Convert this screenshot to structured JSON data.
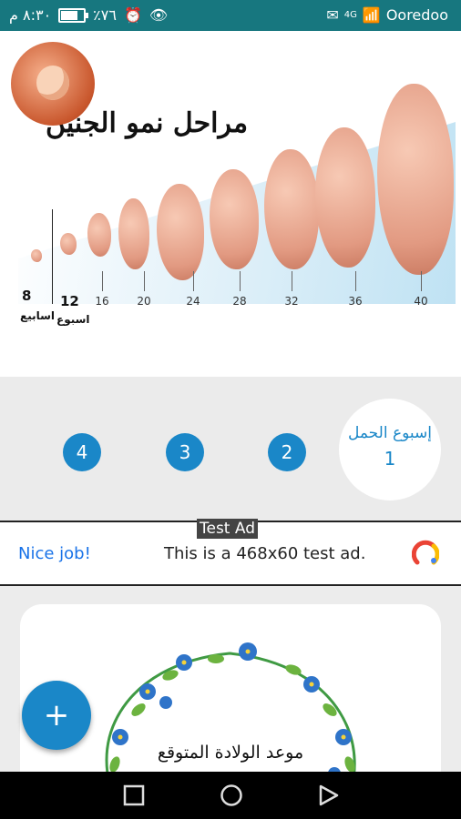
{
  "status_bar": {
    "time": "٨:٣٠ م",
    "battery_percent": "٪٧٦",
    "battery_level": 0.76,
    "carrier": "Ooredoo",
    "signal_label": "4G"
  },
  "hero": {
    "title": "مراحل نمو الجنين",
    "week_ticks": [
      "16",
      "20",
      "24",
      "28",
      "32",
      "36",
      "40"
    ],
    "label_8": "8",
    "label_8_caption": "اسابيع",
    "label_12": "12",
    "label_12_caption": "اسبوع"
  },
  "week_selector": {
    "current_label": "إسبوع الحمل",
    "current_week": "1",
    "next_weeks": [
      "2",
      "3",
      "4"
    ]
  },
  "ad": {
    "tag": "Test Ad",
    "headline": "Nice job!",
    "text": "This is a 468x60 test ad."
  },
  "card": {
    "text": "موعد الولادة المتوقع"
  },
  "fab": {
    "label": "+"
  }
}
